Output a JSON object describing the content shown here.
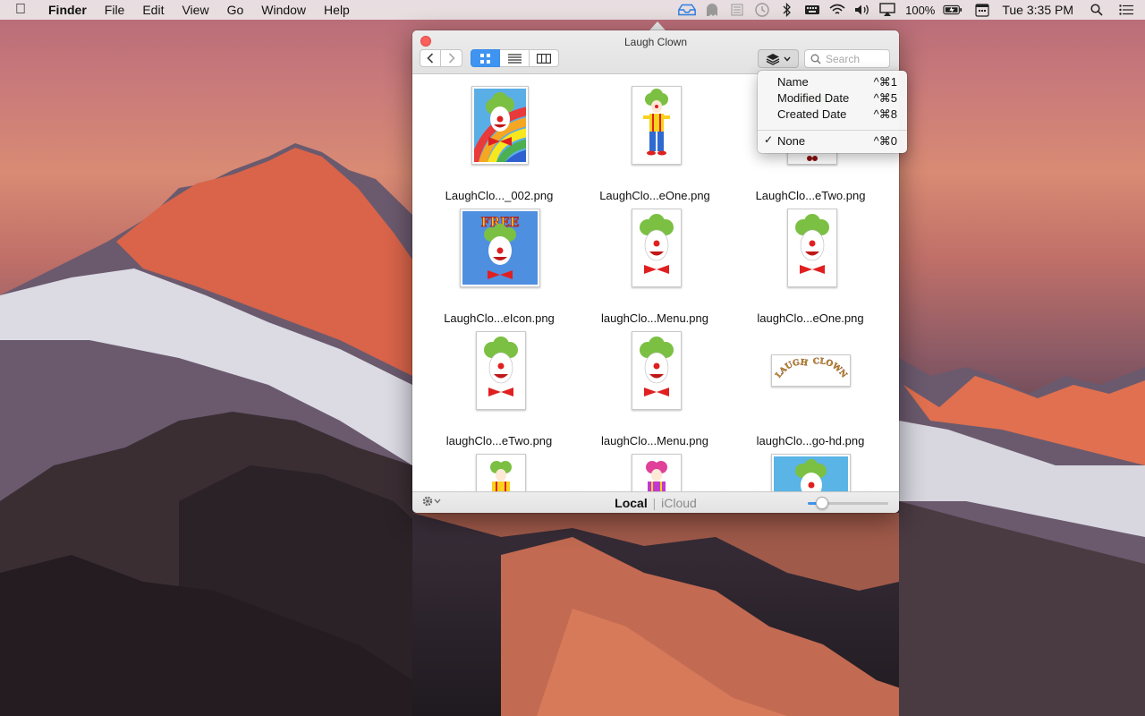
{
  "menubar": {
    "app_name": "Finder",
    "menus": [
      "File",
      "Edit",
      "View",
      "Go",
      "Window",
      "Help"
    ],
    "battery": "100%",
    "clock": "Tue 3:35 PM"
  },
  "window": {
    "title": "Laugh Clown",
    "search_placeholder": "Search",
    "location_local": "Local",
    "location_separator": "|",
    "location_icloud": "iCloud",
    "zoom_level": 0.18
  },
  "files": [
    {
      "name": "LaughClo..._002.png",
      "thumb": "clown-rainbow"
    },
    {
      "name": "LaughClo...eOne.png",
      "thumb": "clown-fullbody"
    },
    {
      "name": "LaughClo...eTwo.png",
      "thumb": "clown-partial"
    },
    {
      "name": "LaughClo...eIcon.png",
      "thumb": "clown-free"
    },
    {
      "name": "laughClo...Menu.png",
      "thumb": "clown-face"
    },
    {
      "name": "laughClo...eOne.png",
      "thumb": "clown-face"
    },
    {
      "name": "laughClo...eTwo.png",
      "thumb": "clown-face"
    },
    {
      "name": "laughClo...Menu.png",
      "thumb": "clown-face"
    },
    {
      "name": "laughClo...go-hd.png",
      "thumb": "clown-logo"
    },
    {
      "name": "",
      "thumb": "clown-yellow"
    },
    {
      "name": "",
      "thumb": "clown-pink"
    },
    {
      "name": "",
      "thumb": "clown-blue"
    }
  ],
  "group_menu": {
    "items": [
      {
        "label": "Name",
        "shortcut": "^⌘1",
        "checked": false
      },
      {
        "label": "Modified Date",
        "shortcut": "^⌘5",
        "checked": false
      },
      {
        "label": "Created Date",
        "shortcut": "^⌘8",
        "checked": false
      },
      {
        "label": "None",
        "shortcut": "^⌘0",
        "checked": true
      }
    ],
    "check_glyph": "✓"
  }
}
